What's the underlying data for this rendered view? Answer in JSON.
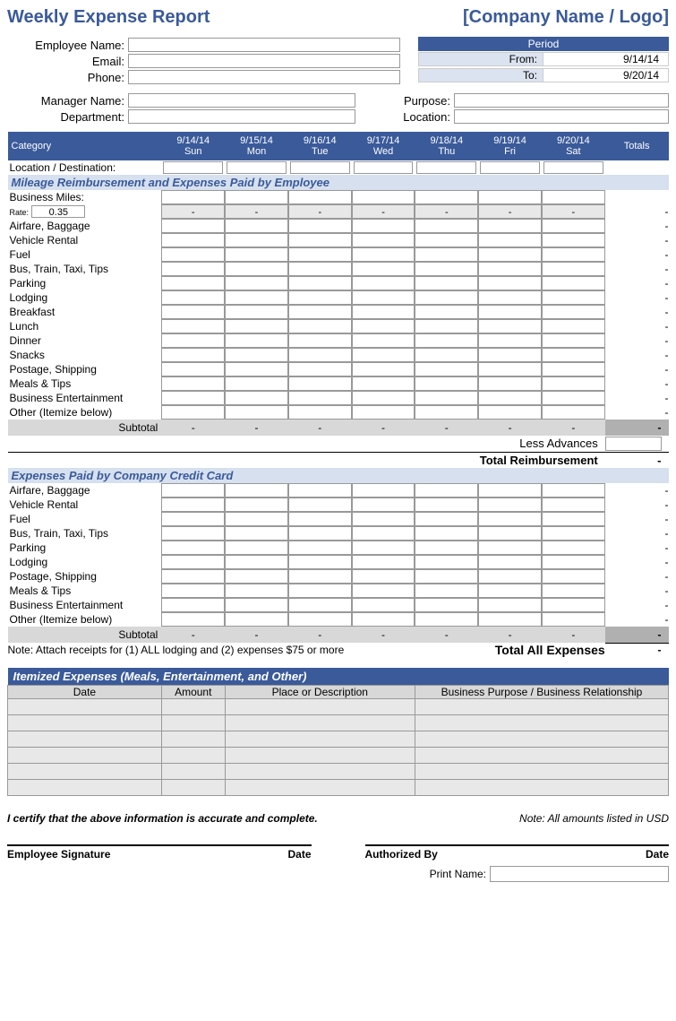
{
  "header": {
    "title": "Weekly Expense Report",
    "company": "[Company Name / Logo]"
  },
  "employee": {
    "name_label": "Employee Name:",
    "email_label": "Email:",
    "phone_label": "Phone:",
    "manager_label": "Manager Name:",
    "dept_label": "Department:",
    "purpose_label": "Purpose:",
    "location_label": "Location:"
  },
  "period": {
    "header": "Period",
    "from_label": "From:",
    "from_val": "9/14/14",
    "to_label": "To:",
    "to_val": "9/20/14"
  },
  "columns": {
    "category": "Category",
    "days": [
      {
        "date": "9/14/14",
        "dow": "Sun"
      },
      {
        "date": "9/15/14",
        "dow": "Mon"
      },
      {
        "date": "9/16/14",
        "dow": "Tue"
      },
      {
        "date": "9/17/14",
        "dow": "Wed"
      },
      {
        "date": "9/18/14",
        "dow": "Thu"
      },
      {
        "date": "9/19/14",
        "dow": "Fri"
      },
      {
        "date": "9/20/14",
        "dow": "Sat"
      }
    ],
    "totals": "Totals"
  },
  "location_row": "Location / Destination:",
  "section1": {
    "title": "Mileage Reimbursement and Expenses Paid by Employee",
    "miles_label": "Business Miles:",
    "rate_label": "Rate:",
    "rate_val": "0.35",
    "rows": [
      "Airfare, Baggage",
      "Vehicle Rental",
      "Fuel",
      "Bus, Train, Taxi, Tips",
      "Parking",
      "Lodging",
      "Breakfast",
      "Lunch",
      "Dinner",
      "Snacks",
      "Postage, Shipping",
      "Meals & Tips",
      "Business Entertainment",
      "Other (Itemize below)"
    ],
    "subtotal": "Subtotal",
    "less_advances": "Less Advances",
    "total_reimb": "Total Reimbursement"
  },
  "section2": {
    "title": "Expenses Paid by Company Credit Card",
    "rows": [
      "Airfare, Baggage",
      "Vehicle Rental",
      "Fuel",
      "Bus, Train, Taxi, Tips",
      "Parking",
      "Lodging",
      "Postage, Shipping",
      "Meals & Tips",
      "Business Entertainment",
      "Other (Itemize below)"
    ],
    "subtotal": "Subtotal",
    "note": "Note:  Attach receipts for (1) ALL lodging and (2) expenses $75 or more",
    "total_all": "Total All Expenses"
  },
  "itemized": {
    "title": "Itemized Expenses (Meals, Entertainment, and Other)",
    "cols": {
      "date": "Date",
      "amount": "Amount",
      "place": "Place or Description",
      "purpose": "Business Purpose / Business Relationship"
    },
    "rows": 6
  },
  "footer": {
    "certify": "I certify that the above information is accurate and complete.",
    "currency_note": "Note: All amounts listed in USD",
    "emp_sig": "Employee Signature",
    "date": "Date",
    "auth_by": "Authorized By",
    "print_name": "Print Name:"
  },
  "dash": "-"
}
